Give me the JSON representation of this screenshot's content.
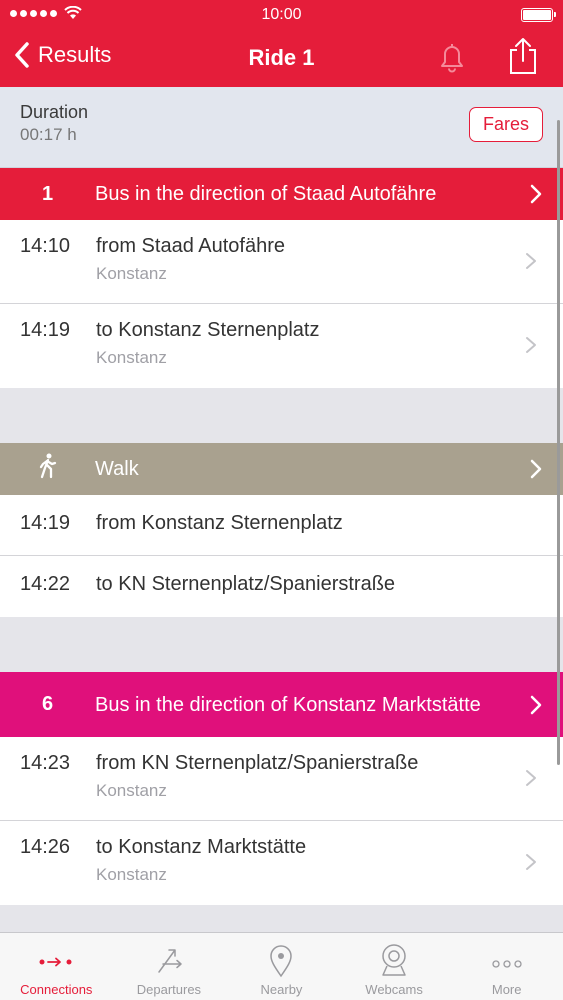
{
  "status_bar": {
    "time": "10:00"
  },
  "nav": {
    "back_label": "Results",
    "title": "Ride 1"
  },
  "summary": {
    "duration_label": "Duration",
    "duration_value": "00:17 h",
    "fares_label": "Fares"
  },
  "legs": [
    {
      "number": "1",
      "title": "Bus in the direction of Staad Autofähre",
      "color": "#e51d3a",
      "stops": [
        {
          "time": "14:10",
          "name": "from Staad Autofähre",
          "city": "Konstanz"
        },
        {
          "time": "14:19",
          "name": "to Konstanz Sternenplatz",
          "city": "Konstanz"
        }
      ]
    },
    {
      "number": "",
      "icon": "walking-person-icon",
      "title": "Walk",
      "color": "#a9a18f",
      "stops": [
        {
          "time": "14:19",
          "name": "from Konstanz Sternenplatz"
        },
        {
          "time": "14:22",
          "name": "to KN Sternenplatz/Spanierstraße"
        }
      ]
    },
    {
      "number": "6",
      "title": "Bus in the direction of Konstanz Marktstätte",
      "color": "#e0107b",
      "stops": [
        {
          "time": "14:23",
          "name": "from KN Sternenplatz/Spanierstraße",
          "city": "Konstanz"
        },
        {
          "time": "14:26",
          "name": "to Konstanz Marktstätte",
          "city": "Konstanz"
        }
      ]
    }
  ],
  "tabs": [
    {
      "label": "Connections",
      "icon": "connections-icon",
      "active": true
    },
    {
      "label": "Departures",
      "icon": "departures-icon"
    },
    {
      "label": "Nearby",
      "icon": "location-pin-icon"
    },
    {
      "label": "Webcams",
      "icon": "webcam-icon"
    },
    {
      "label": "More",
      "icon": "more-dots-icon"
    }
  ],
  "colors": {
    "accent": "#e51d3a",
    "walk": "#a9a18f",
    "line6": "#e0107b"
  }
}
